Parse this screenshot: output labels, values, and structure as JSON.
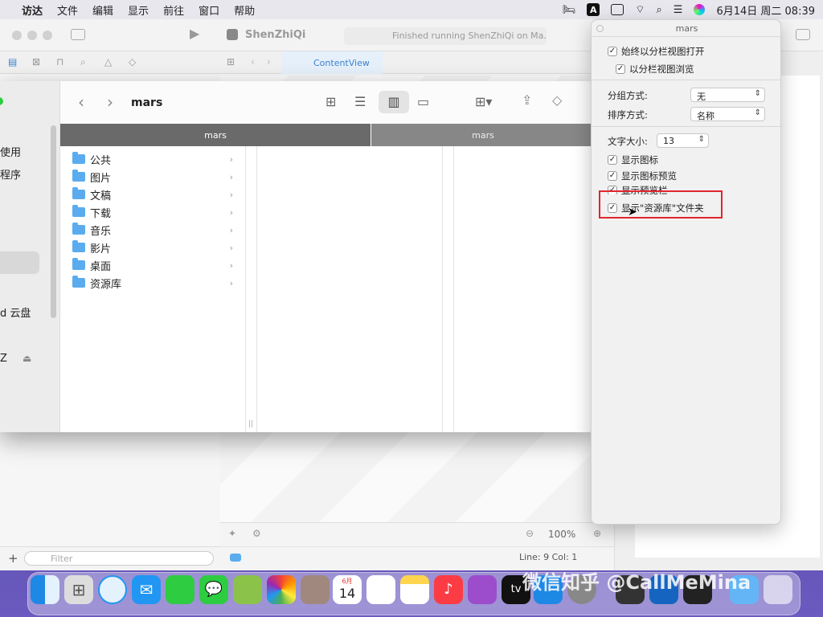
{
  "menubar": {
    "items": [
      "访达",
      "文件",
      "编辑",
      "显示",
      "前往",
      "窗口",
      "帮助"
    ],
    "clock": "6月14日 周二 08:39",
    "input_icon": "A"
  },
  "xcode": {
    "project": "ShenZhiQi",
    "status": "Finished running ShenZhiQi on Ma...",
    "tab": "ContentView",
    "filter_placeholder": "Filter",
    "zoom": "100%",
    "line_col": "Line: 9  Col: 1"
  },
  "sidebar": {
    "fragments": [
      "使用",
      "程序",
      "d 云盘",
      "Z"
    ]
  },
  "finder": {
    "title": "mars",
    "column1": "mars",
    "column2": "mars",
    "items": [
      "公共",
      "图片",
      "文稿",
      "下载",
      "音乐",
      "影片",
      "桌面",
      "资源库"
    ]
  },
  "panel": {
    "title": "mars",
    "always_open": "始终以分栏视图打开",
    "browse": "以分栏视图浏览",
    "group_label": "分组方式:",
    "group_value": "无",
    "sort_label": "排序方式:",
    "sort_value": "名称",
    "text_size_label": "文字大小:",
    "text_size_value": "13",
    "show_icons": "显示图标",
    "show_icon_preview": "显示图标预览",
    "show_preview_column": "显示预览栏",
    "show_library": "显示\"资源库\"文件夹"
  },
  "dock": {
    "calendar_month": "6月",
    "calendar_day": "14",
    "tv_label": "tv"
  },
  "watermark": "微信知乎 @CallMeMina",
  "colors": {
    "highlight": "#e1252d",
    "folder": "#5aacef",
    "accent": "#3b82d0"
  }
}
